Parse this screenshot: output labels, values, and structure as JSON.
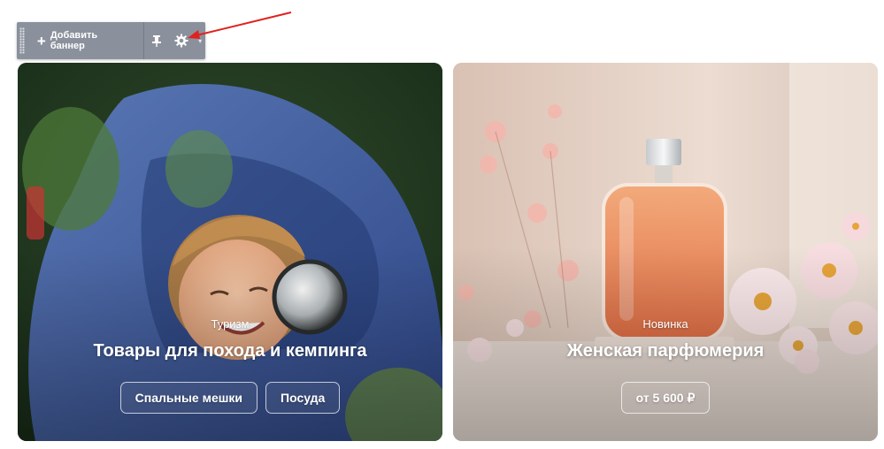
{
  "toolbar": {
    "add_banner_label": "Добавить баннер",
    "pin_icon": "pin-icon",
    "settings_icon": "gear-icon",
    "caret_icon": "chevron-down-icon"
  },
  "annotation": {
    "arrow_color": "#e0211e"
  },
  "banners": [
    {
      "eyebrow": "Туризм",
      "title": "Товары для похода и кемпинга",
      "chips": [
        "Спальные мешки",
        "Посуда"
      ]
    },
    {
      "eyebrow": "Новинка",
      "title": "Женская парфюмерия",
      "chips": [
        "от 5 600 ₽"
      ]
    }
  ]
}
